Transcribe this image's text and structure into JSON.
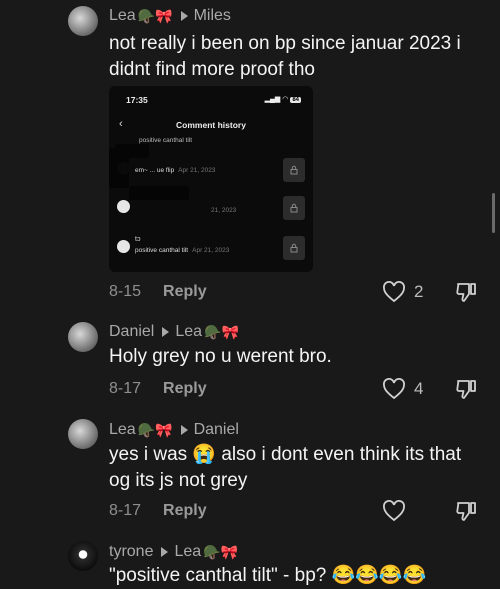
{
  "comments": [
    {
      "author": "Lea",
      "author_emoji": "🪖🎀",
      "reply_to": "Miles",
      "text_line1": "not really i been on bp since januar 2023 i",
      "text_line2": "didnt find more proof tho",
      "date": "8-15",
      "reply_label": "Reply",
      "likes": "2"
    },
    {
      "author": "Daniel",
      "reply_to": "Lea",
      "reply_to_emoji": "🪖🎀",
      "text_line1": "Holy grey no u werent bro.",
      "date": "8-17",
      "reply_label": "Reply",
      "likes": "4"
    },
    {
      "author": "Lea",
      "author_emoji": "🪖🎀",
      "reply_to": "Daniel",
      "text_line1": "yes i was 😭 also i dont even think its that",
      "text_line2": "og its js not grey",
      "date": "8-17",
      "reply_label": "Reply",
      "likes": ""
    },
    {
      "author": "tyrone",
      "reply_to": "Lea",
      "reply_to_emoji": "🪖🎀",
      "text_line1": "\"positive canthal tilt\" - bp? 😂😂😂😂"
    }
  ],
  "screenshot": {
    "time": "17:35",
    "battery": "84",
    "title": "Comment history",
    "top_text": "positive canthal tilt",
    "rows": [
      {
        "text": "em~ ... ue flip",
        "date": "Apr 21, 2023"
      },
      {
        "text": "",
        "date": "21, 2023"
      },
      {
        "text": "positive canthal tilt",
        "date": "Apr 21, 2023"
      }
    ]
  },
  "icons": {
    "like": "heart-outline-icon",
    "dislike": "thumbs-down-icon",
    "back": "chevron-left-icon",
    "lock": "lock-icon"
  },
  "colors": {
    "background": "#191919",
    "text": "#f4f4f4",
    "muted": "#8f8f8f"
  }
}
